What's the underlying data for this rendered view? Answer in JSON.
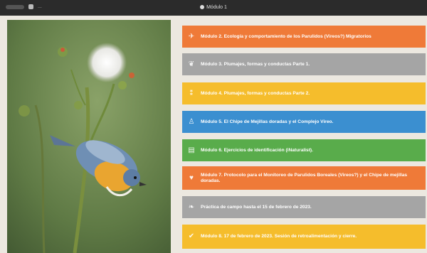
{
  "window": {
    "title": "Módulo 1",
    "crumb": "...",
    "colors": {
      "bar": "#2b2b2b"
    }
  },
  "modules": [
    {
      "label": "Módulo 2. Ecología y comportamiento de los Parulidos (Vireos?) Migratorios",
      "color": "#ef7a38",
      "icon": "bird-icon"
    },
    {
      "label": "Módulo 3. Plumajes, formas y conductas Parte 1.",
      "color": "#a5a5a5",
      "icon": "feather-icon"
    },
    {
      "label": "Módulo 4. Plumajes, formas y conductas Parte 2.",
      "color": "#f5bd2c",
      "icon": "footprints-icon"
    },
    {
      "label": "Módulo 5. El Chipe de Mejillas doradas y el Complejo Vireo.",
      "color": "#3b8fd0",
      "icon": "person-icon"
    },
    {
      "label": "Módulo 6. Ejercicios de identificación (iNaturalist).",
      "color": "#59ac4b",
      "icon": "calendar-icon"
    },
    {
      "label": "Módulo 7. Protocolo para el Monitoreo de Parulidos Boreales (Vireos?) y el Chipe de mejillas doradas.",
      "color": "#ef7a38",
      "icon": "heart-icon"
    },
    {
      "label": "Práctica de campo hasta el 15 de febrero de 2023.",
      "color": "#a5a5a5",
      "icon": "bird-icon"
    },
    {
      "label": "Módulo 8. 17 de febrero de 2023. Sesión de retroalimentación y cierre.",
      "color": "#f5bd2c",
      "icon": "check-icon"
    }
  ]
}
